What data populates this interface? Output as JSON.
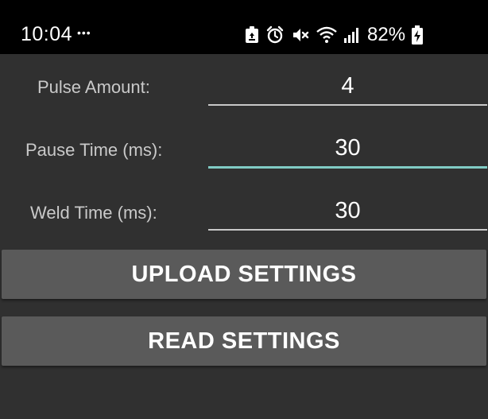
{
  "status_bar": {
    "time": "10:04",
    "notification_dots": "•••",
    "battery_percent": "82%",
    "icons": [
      "recycle-notification-icon",
      "alarm-icon",
      "mute-icon",
      "wifi-icon",
      "signal-icon",
      "battery-charging-icon"
    ]
  },
  "form": {
    "pulse_amount": {
      "label": "Pulse Amount:",
      "value": "4"
    },
    "pause_time": {
      "label": "Pause Time (ms):",
      "value": "30"
    },
    "weld_time": {
      "label": "Weld Time (ms):",
      "value": "30"
    }
  },
  "buttons": {
    "upload": "UPLOAD SETTINGS",
    "read": "READ SETTINGS"
  },
  "colors": {
    "background": "#303030",
    "status_bar": "#000000",
    "focus_accent": "#80cbc4",
    "button": "#5a5a5a"
  }
}
